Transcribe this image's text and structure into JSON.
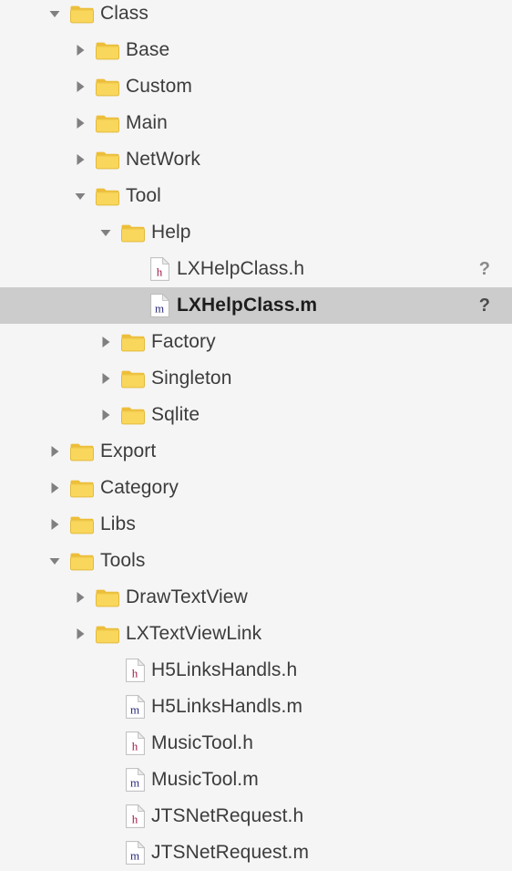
{
  "panel": {
    "name": "xcode-project-navigator",
    "background_color": "#f5f5f5",
    "selection_color": "#cccccc",
    "text_color": "#3c3c3c",
    "folder_color": "#f7d14c",
    "header_icon_color": "#808080"
  },
  "icons": {
    "expanded": "disclosure-triangle-down-icon",
    "collapsed": "disclosure-triangle-right-icon",
    "folder": "folder-icon",
    "header_file": "h-file-icon",
    "source_file": "m-file-icon",
    "status_unknown": "question-mark-status-icon"
  },
  "rows": [
    {
      "label": "Class",
      "type": "folder",
      "state": "expanded",
      "depth": 1,
      "selected": false,
      "status": ""
    },
    {
      "label": "Base",
      "type": "folder",
      "state": "collapsed",
      "depth": 2,
      "selected": false,
      "status": ""
    },
    {
      "label": "Custom",
      "type": "folder",
      "state": "collapsed",
      "depth": 2,
      "selected": false,
      "status": ""
    },
    {
      "label": "Main",
      "type": "folder",
      "state": "collapsed",
      "depth": 2,
      "selected": false,
      "status": ""
    },
    {
      "label": "NetWork",
      "type": "folder",
      "state": "collapsed",
      "depth": 2,
      "selected": false,
      "status": ""
    },
    {
      "label": "Tool",
      "type": "folder",
      "state": "expanded",
      "depth": 2,
      "selected": false,
      "status": ""
    },
    {
      "label": "Help",
      "type": "folder",
      "state": "expanded",
      "depth": 3,
      "selected": false,
      "status": ""
    },
    {
      "label": "LXHelpClass.h",
      "type": "file-h",
      "state": "leaf",
      "depth": 4,
      "selected": false,
      "status": "?"
    },
    {
      "label": "LXHelpClass.m",
      "type": "file-m",
      "state": "leaf",
      "depth": 4,
      "selected": true,
      "status": "?"
    },
    {
      "label": "Factory",
      "type": "folder",
      "state": "collapsed",
      "depth": 3,
      "selected": false,
      "status": ""
    },
    {
      "label": "Singleton",
      "type": "folder",
      "state": "collapsed",
      "depth": 3,
      "selected": false,
      "status": ""
    },
    {
      "label": "Sqlite",
      "type": "folder",
      "state": "collapsed",
      "depth": 3,
      "selected": false,
      "status": ""
    },
    {
      "label": "Export",
      "type": "folder",
      "state": "collapsed",
      "depth": 1,
      "selected": false,
      "status": ""
    },
    {
      "label": "Category",
      "type": "folder",
      "state": "collapsed",
      "depth": 1,
      "selected": false,
      "status": ""
    },
    {
      "label": "Libs",
      "type": "folder",
      "state": "collapsed",
      "depth": 1,
      "selected": false,
      "status": ""
    },
    {
      "label": "Tools",
      "type": "folder",
      "state": "expanded",
      "depth": 1,
      "selected": false,
      "status": ""
    },
    {
      "label": "DrawTextView",
      "type": "folder",
      "state": "collapsed",
      "depth": 2,
      "selected": false,
      "status": ""
    },
    {
      "label": "LXTextViewLink",
      "type": "folder",
      "state": "collapsed",
      "depth": 2,
      "selected": false,
      "status": ""
    },
    {
      "label": "H5LinksHandls.h",
      "type": "file-h",
      "state": "leaf",
      "depth": 3,
      "selected": false,
      "status": ""
    },
    {
      "label": "H5LinksHandls.m",
      "type": "file-m",
      "state": "leaf",
      "depth": 3,
      "selected": false,
      "status": ""
    },
    {
      "label": "MusicTool.h",
      "type": "file-h",
      "state": "leaf",
      "depth": 3,
      "selected": false,
      "status": ""
    },
    {
      "label": "MusicTool.m",
      "type": "file-m",
      "state": "leaf",
      "depth": 3,
      "selected": false,
      "status": ""
    },
    {
      "label": "JTSNetRequest.h",
      "type": "file-h",
      "state": "leaf",
      "depth": 3,
      "selected": false,
      "status": ""
    },
    {
      "label": "JTSNetRequest.m",
      "type": "file-m",
      "state": "leaf",
      "depth": 3,
      "selected": false,
      "status": ""
    }
  ]
}
